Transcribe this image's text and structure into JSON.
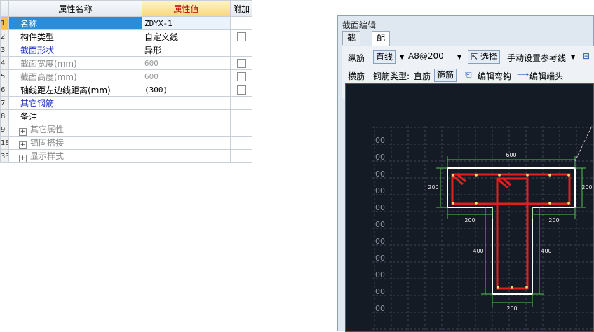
{
  "grid": {
    "headers": {
      "name": "属性名称",
      "value": "属性值",
      "extra": "附加"
    },
    "rows": [
      {
        "num": "1",
        "name": "名称",
        "value": "ZDYX-1",
        "style": "blue",
        "selected": true
      },
      {
        "num": "2",
        "name": "构件类型",
        "value": "自定义线",
        "style": "",
        "checkbox": true
      },
      {
        "num": "3",
        "name": "截面形状",
        "value": "异形",
        "style": "blue"
      },
      {
        "num": "4",
        "name": "截面宽度(mm)",
        "value": "600",
        "style": "gray",
        "checkbox": true
      },
      {
        "num": "5",
        "name": "截面高度(mm)",
        "value": "600",
        "style": "gray",
        "checkbox": true
      },
      {
        "num": "6",
        "name": "轴线距左边线距离(mm)",
        "value": "(300)",
        "style": "",
        "checkbox": true
      },
      {
        "num": "7",
        "name": "其它钢筋",
        "value": "",
        "style": "blue"
      },
      {
        "num": "8",
        "name": "备注",
        "value": "",
        "style": ""
      },
      {
        "num": "9",
        "name": "其它属性",
        "value": "",
        "style": "gray",
        "expand": "+"
      },
      {
        "num": "18",
        "name": "锚固搭接",
        "value": "",
        "style": "gray",
        "expand": "+"
      },
      {
        "num": "33",
        "name": "显示样式",
        "value": "",
        "style": "gray",
        "expand": "+"
      }
    ]
  },
  "editor": {
    "title": "截面编辑",
    "tabs": [
      "截面",
      "配筋"
    ],
    "active_tab": 1,
    "toolbar": {
      "longitudinal": "纵筋",
      "line_mode": "直线",
      "spec": "A8@200",
      "select": "选择",
      "manual_ref": "手动设置参考线",
      "transverse": "横筋",
      "rebar_type_label": "钢筋类型:",
      "straight": "直筋",
      "stirrup": "箍筋",
      "edit_hook": "编辑弯钩",
      "edit_end": "编辑端头"
    },
    "drawing": {
      "dim_top": "600",
      "dim_left": "200",
      "dim_right": "200",
      "dim_flange_left": "200",
      "dim_flange_right": "200",
      "dim_web_height": "400",
      "dim_web_height_right": "400",
      "dim_bottom": "200",
      "grid_labels": [
        "00",
        "00",
        "00",
        "00",
        "00",
        "00",
        "00",
        "00",
        "00",
        "00",
        "00"
      ]
    }
  }
}
